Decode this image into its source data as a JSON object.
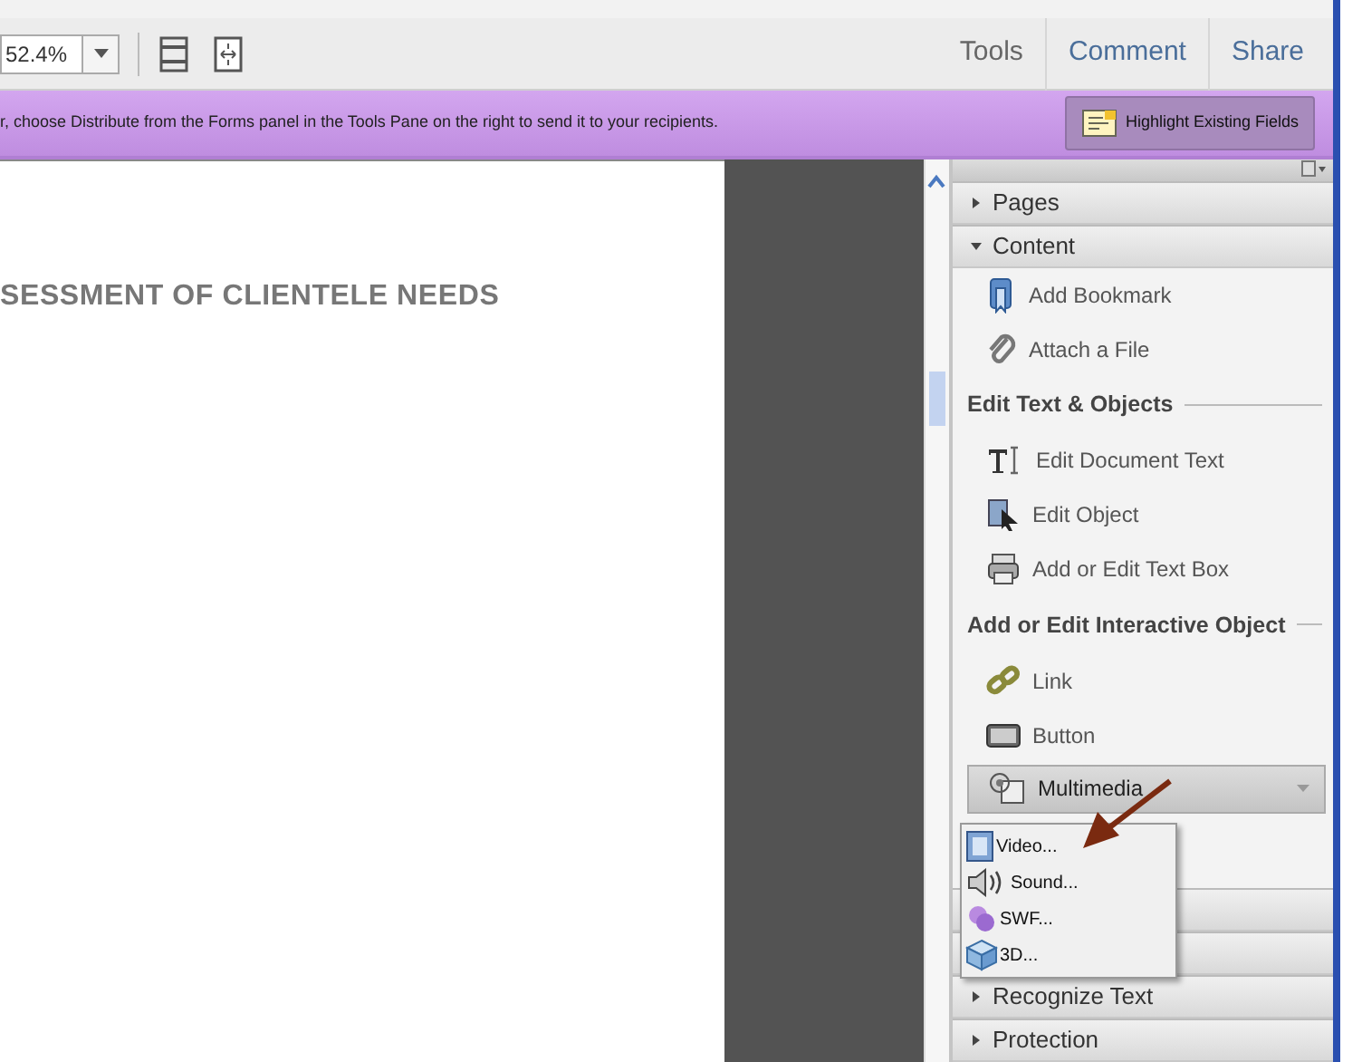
{
  "toolbar": {
    "zoom_value": "52.4%",
    "tabs": [
      {
        "label": "Tools",
        "selected": true
      },
      {
        "label": "Comment",
        "selected": false
      },
      {
        "label": "Share",
        "selected": false
      }
    ]
  },
  "message_bar": {
    "text": "r, choose Distribute from the Forms panel in the Tools Pane on the right to send it to your recipients.",
    "button": "Highlight Existing Fields"
  },
  "document": {
    "heading": "SESSMENT OF CLIENTELE NEEDS"
  },
  "panel": {
    "sections": [
      {
        "title": "Pages",
        "expanded": false
      },
      {
        "title": "Content",
        "expanded": true,
        "items": [
          {
            "kind": "item",
            "label": "Add Bookmark"
          },
          {
            "kind": "item",
            "label": "Attach a File"
          },
          {
            "kind": "heading",
            "label": "Edit Text & Objects"
          },
          {
            "kind": "item",
            "label": "Edit Document Text"
          },
          {
            "kind": "item",
            "label": "Edit Object"
          },
          {
            "kind": "item",
            "label": "Add or Edit Text Box"
          },
          {
            "kind": "heading",
            "label": "Add or Edit Interactive Object"
          },
          {
            "kind": "item",
            "label": "Link"
          },
          {
            "kind": "item",
            "label": "Button"
          },
          {
            "kind": "dropdown",
            "label": "Multimedia"
          }
        ]
      },
      {
        "expanded": false
      },
      {
        "expanded": false
      },
      {
        "title": "Recognize Text",
        "expanded": false
      },
      {
        "title": "Protection",
        "expanded": false
      }
    ],
    "menu": [
      {
        "label": "Video..."
      },
      {
        "label": "Sound..."
      },
      {
        "label": "SWF..."
      },
      {
        "label": "3D..."
      }
    ]
  }
}
